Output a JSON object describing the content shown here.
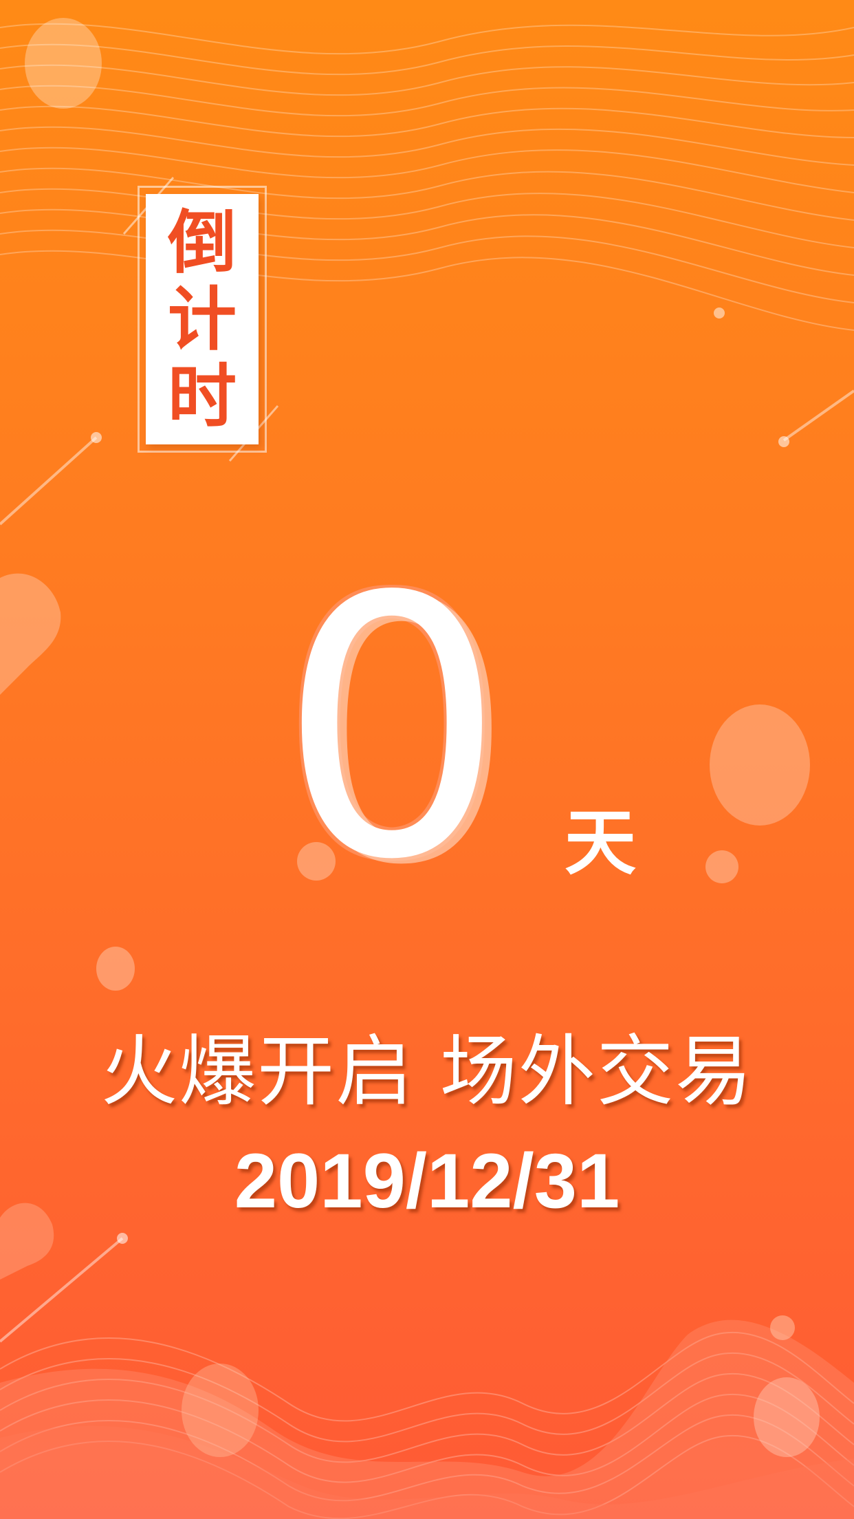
{
  "poster": {
    "badge_chars": [
      "倒",
      "计",
      "时"
    ],
    "count_value": "0",
    "count_unit": "天",
    "slogan": "火爆开启 场外交易",
    "date": "2019/12/31"
  },
  "colors": {
    "background_top": "#ff8a16",
    "background_bottom": "#ff5a36",
    "badge_text": "#f04e23",
    "text": "#ffffff"
  }
}
